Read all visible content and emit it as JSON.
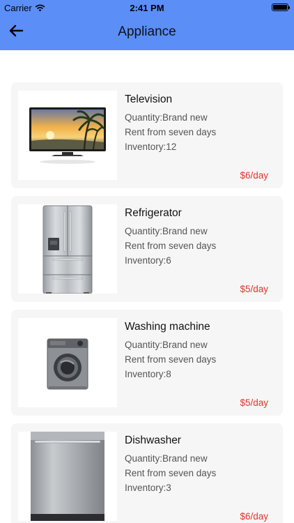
{
  "status_bar": {
    "carrier": "Carrier",
    "time": "2:41 PM"
  },
  "nav": {
    "title": "Appliance"
  },
  "colors": {
    "header": "#5b8ef7",
    "card": "#f6f6f6",
    "price": "#e0342f"
  },
  "items": [
    {
      "name": "Television",
      "quantity": "Quantity:Brand new",
      "rent": "Rent from seven days",
      "inventory": "Inventory:12",
      "price": "$6/day",
      "image": "television-image"
    },
    {
      "name": "Refrigerator",
      "quantity": "Quantity:Brand new",
      "rent": "Rent from seven days",
      "inventory": "Inventory:6",
      "price": "$5/day",
      "image": "refrigerator-image"
    },
    {
      "name": "Washing machine",
      "quantity": "Quantity:Brand new",
      "rent": "Rent from seven days",
      "inventory": "Inventory:8",
      "price": "$5/day",
      "image": "washing-machine-image"
    },
    {
      "name": "Dishwasher",
      "quantity": "Quantity:Brand new",
      "rent": "Rent from seven days",
      "inventory": "Inventory:3",
      "price": "$6/day",
      "image": "dishwasher-image"
    }
  ]
}
